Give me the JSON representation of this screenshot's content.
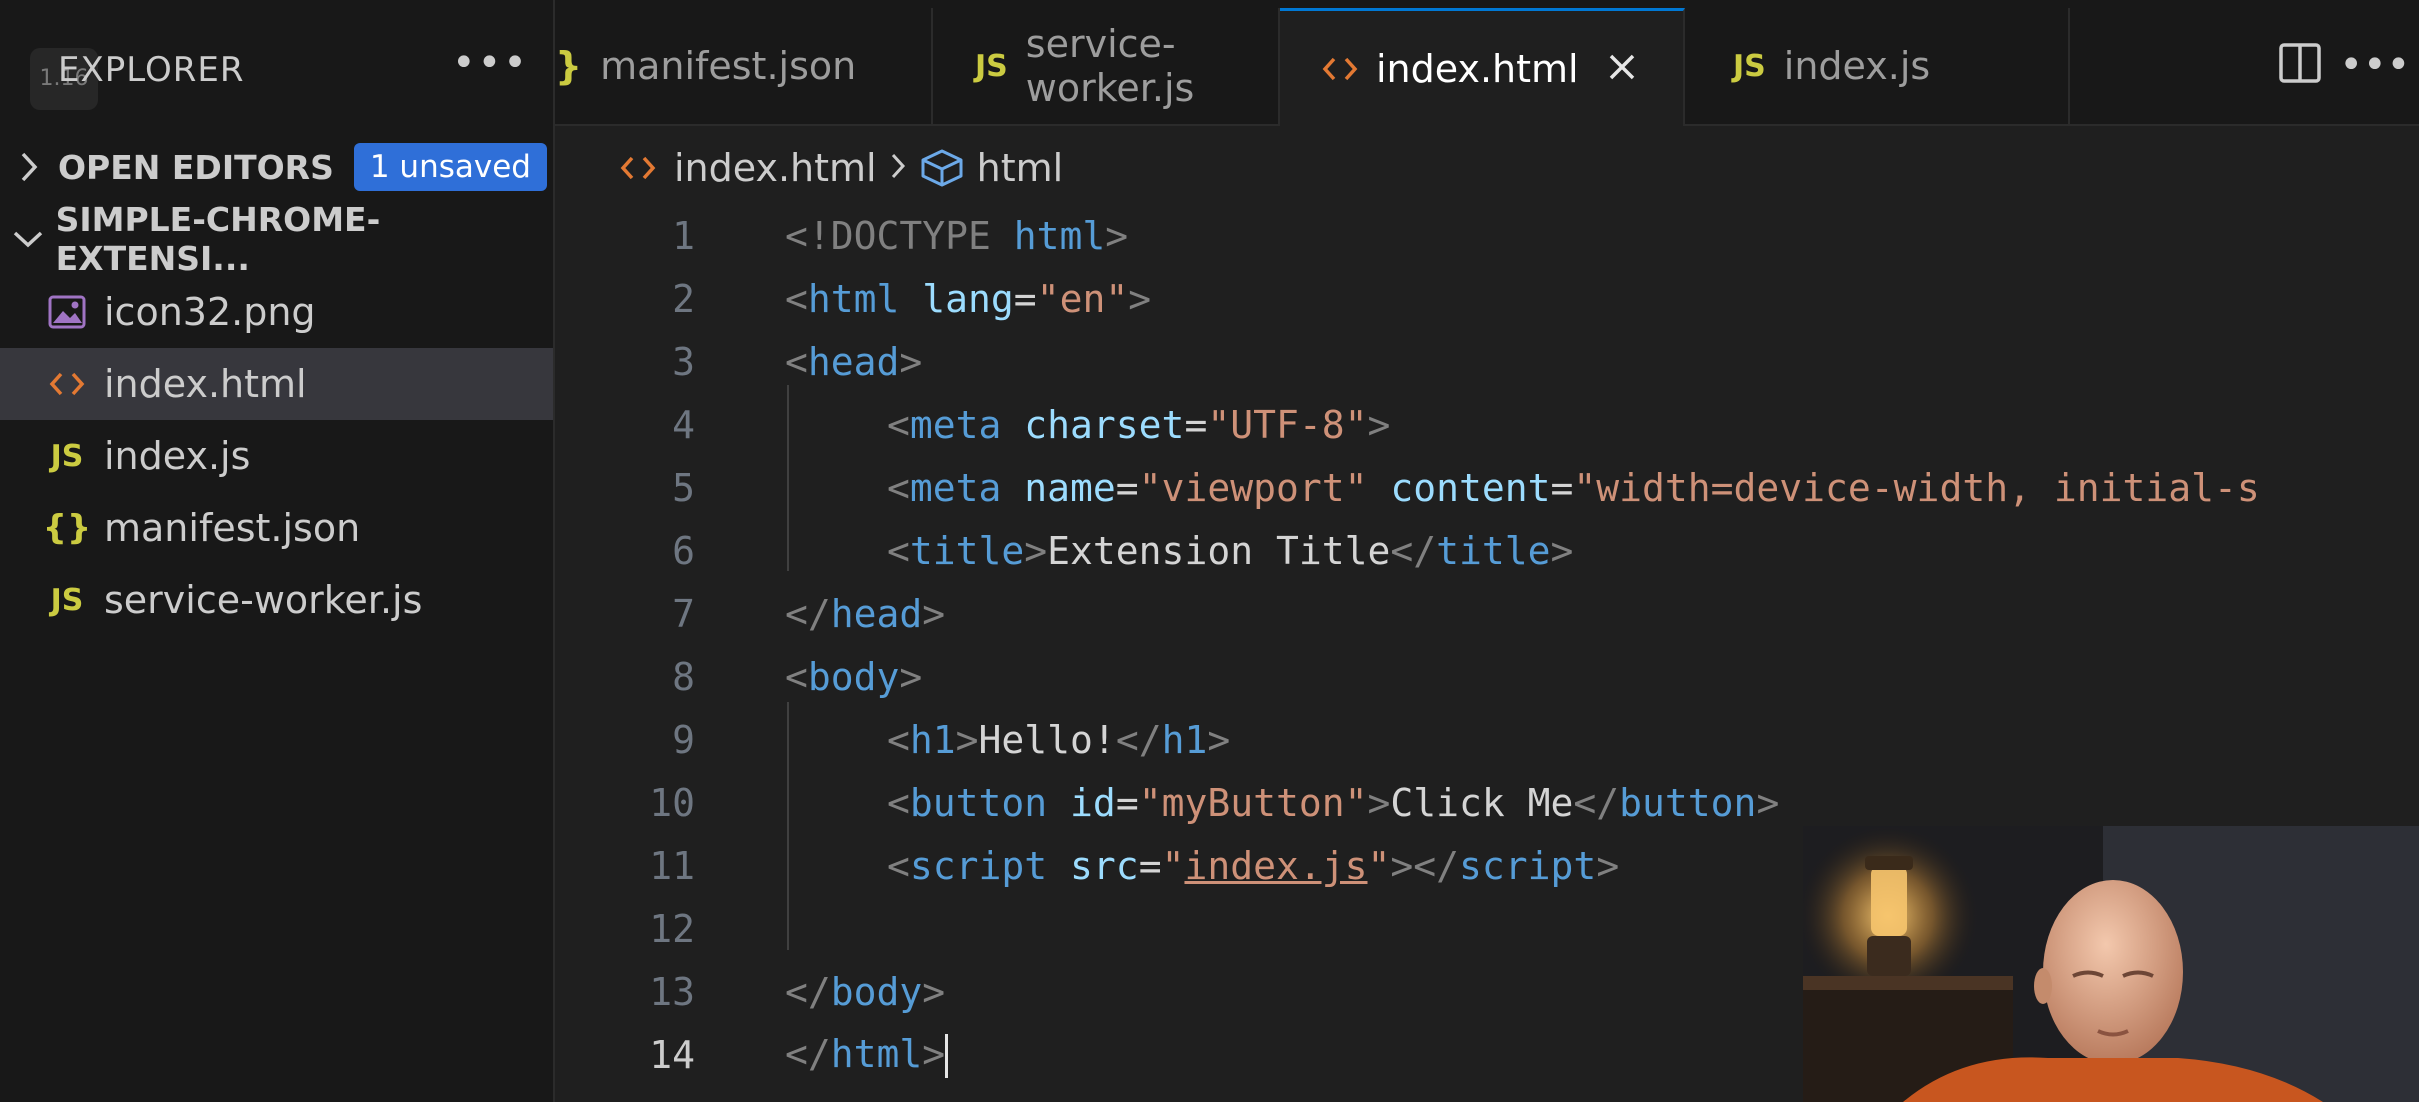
{
  "sidebar": {
    "title": "EXPLORER",
    "version": "1.16",
    "open_editors": {
      "label": "OPEN EDITORS",
      "badge": "1 unsaved"
    },
    "folder": {
      "label": "SIMPLE-CHROME-EXTENSI..."
    },
    "files": [
      {
        "name": "icon32.png",
        "icon": "image-file-icon"
      },
      {
        "name": "index.html",
        "icon": "html-file-icon",
        "selected": true
      },
      {
        "name": "index.js",
        "icon": "js-file-icon"
      },
      {
        "name": "manifest.json",
        "icon": "json-file-icon"
      },
      {
        "name": "service-worker.js",
        "icon": "js-file-icon"
      }
    ]
  },
  "tabs": [
    {
      "label": "manifest.json",
      "icon": "json-file-icon",
      "icon_text": "}"
    },
    {
      "label": "service-worker.js",
      "icon": "js-file-icon",
      "icon_text": "JS"
    },
    {
      "label": "index.html",
      "icon": "html-file-icon",
      "icon_text": "<>",
      "active": true
    },
    {
      "label": "index.js",
      "icon": "js-file-icon",
      "icon_text": "JS"
    }
  ],
  "breadcrumb": {
    "file": "index.html",
    "symbol": "html"
  },
  "editor": {
    "line_numbers": [
      "1",
      "2",
      "3",
      "4",
      "5",
      "6",
      "7",
      "8",
      "9",
      "10",
      "11",
      "12",
      "13",
      "14"
    ],
    "current_line": "14",
    "code": {
      "l1_doctype": "<!DOCTYPE",
      "l1_html": " html",
      "l1_close": ">",
      "l2_open": "<",
      "l2_tag": "html",
      "l2_attr": " lang",
      "l2_eq": "=",
      "l2_val": "\"en\"",
      "l2_close": ">",
      "l3_open": "<",
      "l3_tag": "head",
      "l3_close": ">",
      "l4_open": "<",
      "l4_tag": "meta",
      "l4_attr": " charset",
      "l4_eq": "=",
      "l4_val": "\"UTF-8\"",
      "l4_close": ">",
      "l5_open": "<",
      "l5_tag": "meta",
      "l5_attr1": " name",
      "l5_eq1": "=",
      "l5_val1": "\"viewport\"",
      "l5_attr2": " content",
      "l5_eq2": "=",
      "l5_val2": "\"width=device-width, initial-s",
      "l6_open": "<",
      "l6_tag": "title",
      "l6_mid": ">",
      "l6_text": "Extension Title",
      "l6_close_open": "</",
      "l6_close_tag": "title",
      "l6_close": ">",
      "l7_open": "</",
      "l7_tag": "head",
      "l7_close": ">",
      "l8_open": "<",
      "l8_tag": "body",
      "l8_close": ">",
      "l9_open": "<",
      "l9_tag": "h1",
      "l9_mid": ">",
      "l9_text": "Hello!",
      "l9_close_open": "</",
      "l9_close_tag": "h1",
      "l9_close": ">",
      "l10_open": "<",
      "l10_tag": "button",
      "l10_attr": " id",
      "l10_eq": "=",
      "l10_val": "\"myButton\"",
      "l10_mid": ">",
      "l10_text": "Click Me",
      "l10_close_open": "</",
      "l10_close_tag": "button",
      "l10_close": ">",
      "l11_open": "<",
      "l11_tag": "script",
      "l11_attr": " src",
      "l11_eq": "=",
      "l11_q1": "\"",
      "l11_val": "index.js",
      "l11_q2": "\"",
      "l11_mid": "></",
      "l11_close_tag": "script",
      "l11_close": ">",
      "l13_open": "</",
      "l13_tag": "body",
      "l13_close": ">",
      "l14_open": "</",
      "l14_tag": "html",
      "l14_close": ">"
    }
  },
  "colors": {
    "accent": "#0078d4",
    "badge": "#2f6fd8",
    "tag": "#569cd6",
    "attribute": "#9cdcfe",
    "string": "#ce9178",
    "js_icon": "#cbcb41",
    "html_icon": "#e37933"
  }
}
